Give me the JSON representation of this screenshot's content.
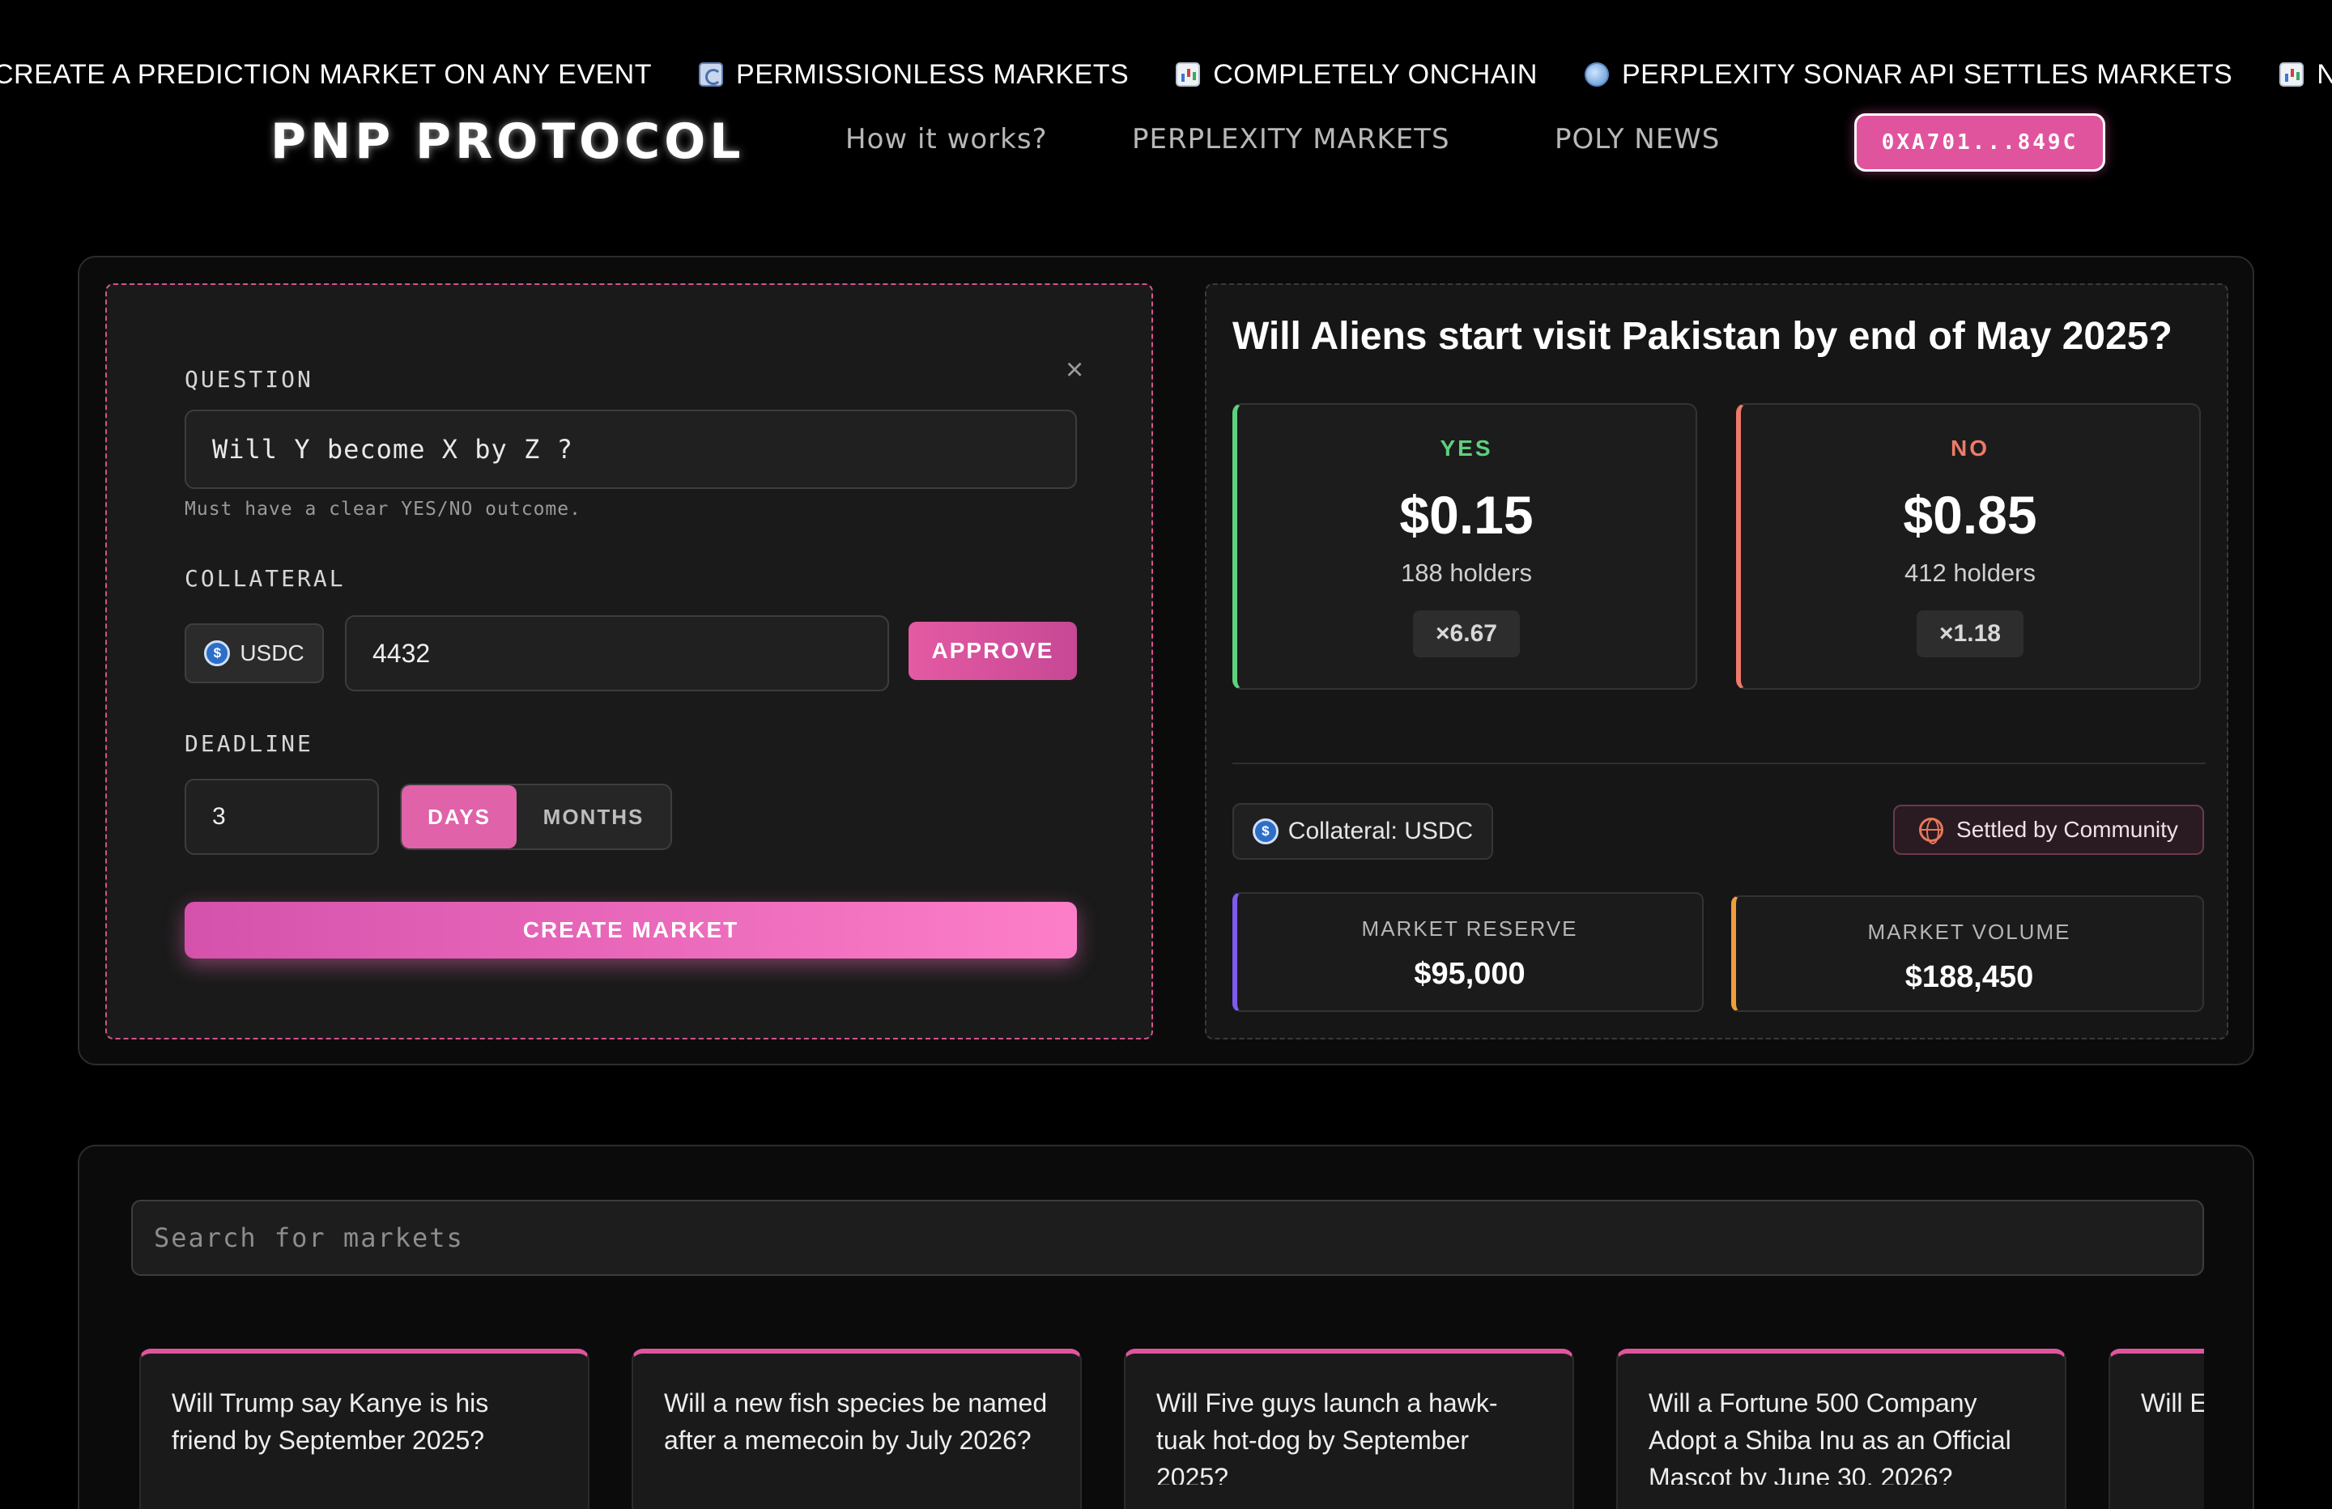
{
  "ticker": [
    {
      "icon": "plus-icon",
      "text": "CREATE A PREDICTION MARKET ON ANY EVENT"
    },
    {
      "icon": "refresh-icon",
      "text": "PERMISSIONLESS MARKETS"
    },
    {
      "icon": "bar-chart-icon",
      "text": "COMPLETELY ONCHAIN"
    },
    {
      "icon": "globe-icon",
      "text": "PERPLEXITY SONAR API SETTLES MARKETS"
    },
    {
      "icon": "bar-chart-icon",
      "text": "NETW"
    }
  ],
  "header": {
    "logo": "PNP PROTOCOL",
    "nav": [
      "How it works?",
      "PERPLEXITY MARKETS",
      "POLY NEWS"
    ],
    "wallet": "0XA701...849C"
  },
  "form": {
    "close": "×",
    "question_label": "QUESTION",
    "question_value": "Will Y become X by Z ?",
    "question_hint": "Must have a clear YES/NO outcome.",
    "collateral_label": "COLLATERAL",
    "token": "USDC",
    "amount": "4432",
    "approve": "APPROVE",
    "deadline_label": "DEADLINE",
    "deadline_value": "3",
    "unit_days": "DAYS",
    "unit_months": "MONTHS",
    "create": "CREATE MARKET"
  },
  "preview": {
    "title": "Will Aliens start visit Pakistan by end of May 2025?",
    "yes": {
      "label": "YES",
      "price": "$0.15",
      "holders": "188 holders",
      "multiplier": "×6.67"
    },
    "no": {
      "label": "NO",
      "price": "$0.85",
      "holders": "412 holders",
      "multiplier": "×1.18"
    },
    "collateral": "Collateral: USDC",
    "settled": "Settled by Community",
    "reserve_label": "MARKET RESERVE",
    "reserve_value": "$95,000",
    "volume_label": "MARKET VOLUME",
    "volume_value": "$188,450"
  },
  "search": {
    "placeholder": "Search for markets"
  },
  "markets": [
    "Will Trump say Kanye is his friend by September 2025?",
    "Will a new fish species be named after a memecoin by July 2026?",
    "Will Five guys launch a hawk-tuak hot-dog by September 2025?",
    "Will a Fortune 500 Company Adopt a Shiba Inu as an Official Mascot by June 30, 2026?",
    "Will E the e"
  ],
  "colors": {
    "accent": "#e0549e",
    "yes": "#5fd07d",
    "no": "#ef7a6a",
    "reserve": "#7d5af0",
    "volume": "#ef9e3a"
  }
}
